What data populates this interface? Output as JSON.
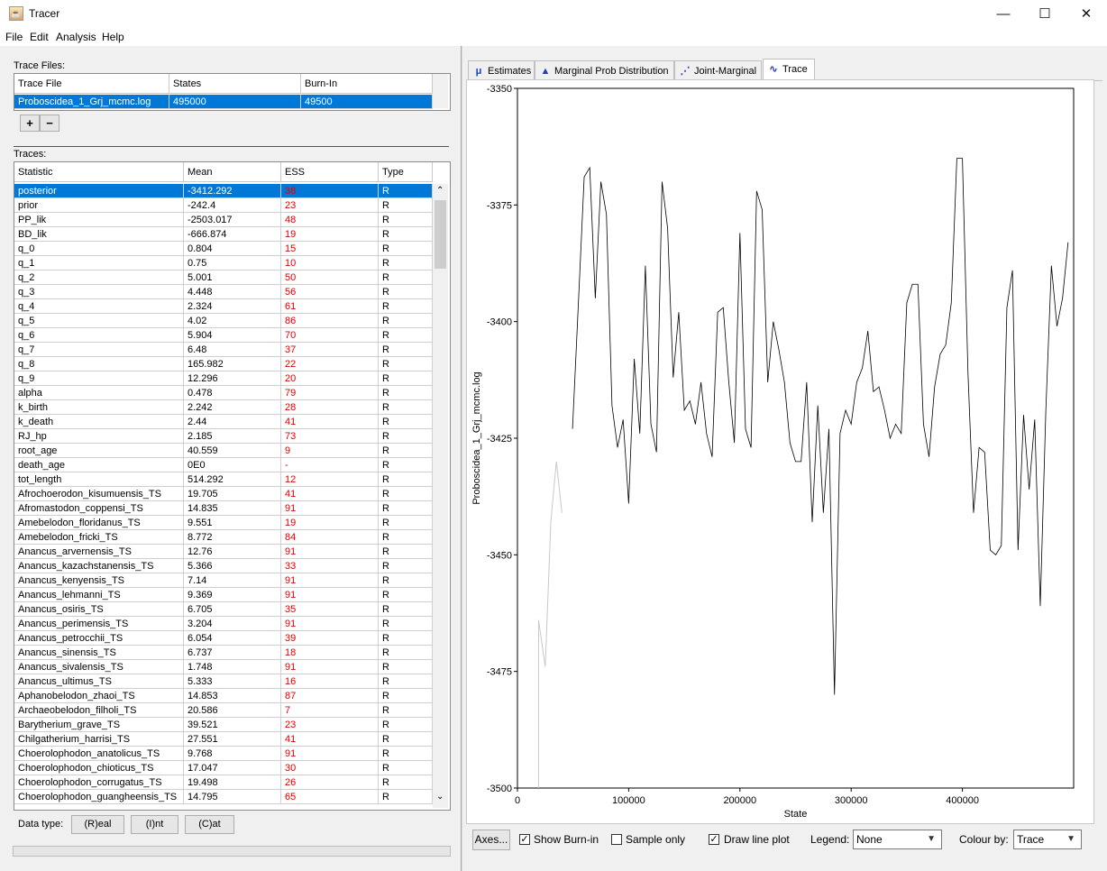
{
  "window": {
    "title": "Tracer",
    "icon": "java-cup-icon",
    "minimize": "—",
    "maximize": "☐",
    "close": "✕"
  },
  "menu": [
    "File",
    "Edit",
    "Analysis",
    "Help"
  ],
  "trace_files": {
    "label": "Trace Files:",
    "headers": [
      "Trace File",
      "States",
      "Burn-In"
    ],
    "rows": [
      {
        "file": "Proboscidea_1_Grj_mcmc.log",
        "states": "495000",
        "burnin": "49500"
      }
    ],
    "add_label": "+",
    "remove_label": "−"
  },
  "traces": {
    "label": "Traces:",
    "headers": [
      "Statistic",
      "Mean",
      "ESS",
      "Type"
    ],
    "rows": [
      [
        "posterior",
        "-3412.292",
        "38",
        "R"
      ],
      [
        "prior",
        "-242.4",
        "23",
        "R"
      ],
      [
        "PP_lik",
        "-2503.017",
        "48",
        "R"
      ],
      [
        "BD_lik",
        "-666.874",
        "19",
        "R"
      ],
      [
        "q_0",
        "0.804",
        "15",
        "R"
      ],
      [
        "q_1",
        "0.75",
        "10",
        "R"
      ],
      [
        "q_2",
        "5.001",
        "50",
        "R"
      ],
      [
        "q_3",
        "4.448",
        "56",
        "R"
      ],
      [
        "q_4",
        "2.324",
        "61",
        "R"
      ],
      [
        "q_5",
        "4.02",
        "86",
        "R"
      ],
      [
        "q_6",
        "5.904",
        "70",
        "R"
      ],
      [
        "q_7",
        "6.48",
        "37",
        "R"
      ],
      [
        "q_8",
        "165.982",
        "22",
        "R"
      ],
      [
        "q_9",
        "12.296",
        "20",
        "R"
      ],
      [
        "alpha",
        "0.478",
        "79",
        "R"
      ],
      [
        "k_birth",
        "2.242",
        "28",
        "R"
      ],
      [
        "k_death",
        "2.44",
        "41",
        "R"
      ],
      [
        "RJ_hp",
        "2.185",
        "73",
        "R"
      ],
      [
        "root_age",
        "40.559",
        "9",
        "R"
      ],
      [
        "death_age",
        "0E0",
        "-",
        "R"
      ],
      [
        "tot_length",
        "514.292",
        "12",
        "R"
      ],
      [
        "Afrochoerodon_kisumuensis_TS",
        "19.705",
        "41",
        "R"
      ],
      [
        "Afromastodon_coppensi_TS",
        "14.835",
        "91",
        "R"
      ],
      [
        "Amebelodon_floridanus_TS",
        "9.551",
        "19",
        "R"
      ],
      [
        "Amebelodon_fricki_TS",
        "8.772",
        "84",
        "R"
      ],
      [
        "Anancus_arvernensis_TS",
        "12.76",
        "91",
        "R"
      ],
      [
        "Anancus_kazachstanensis_TS",
        "5.366",
        "33",
        "R"
      ],
      [
        "Anancus_kenyensis_TS",
        "7.14",
        "91",
        "R"
      ],
      [
        "Anancus_lehmanni_TS",
        "9.369",
        "91",
        "R"
      ],
      [
        "Anancus_osiris_TS",
        "6.705",
        "35",
        "R"
      ],
      [
        "Anancus_perimensis_TS",
        "3.204",
        "91",
        "R"
      ],
      [
        "Anancus_petrocchii_TS",
        "6.054",
        "39",
        "R"
      ],
      [
        "Anancus_sinensis_TS",
        "6.737",
        "18",
        "R"
      ],
      [
        "Anancus_sivalensis_TS",
        "1.748",
        "91",
        "R"
      ],
      [
        "Anancus_ultimus_TS",
        "5.333",
        "16",
        "R"
      ],
      [
        "Aphanobelodon_zhaoi_TS",
        "14.853",
        "87",
        "R"
      ],
      [
        "Archaeobelodon_filholi_TS",
        "20.586",
        "7",
        "R"
      ],
      [
        "Barytherium_grave_TS",
        "39.521",
        "23",
        "R"
      ],
      [
        "Chilgatherium_harrisi_TS",
        "27.551",
        "41",
        "R"
      ],
      [
        "Choerolophodon_anatolicus_TS",
        "9.768",
        "91",
        "R"
      ],
      [
        "Choerolophodon_chioticus_TS",
        "17.047",
        "30",
        "R"
      ],
      [
        "Choerolophodon_corrugatus_TS",
        "19.498",
        "26",
        "R"
      ],
      [
        "Choerolophodon_guangheensis_TS",
        "14.795",
        "65",
        "R"
      ]
    ],
    "selected_index": 0
  },
  "data_type": {
    "label": "Data type:",
    "buttons": [
      "(R)eal",
      "(I)nt",
      "(C)at"
    ]
  },
  "tabs": [
    {
      "label": "Estimates",
      "icon": "mu-icon"
    },
    {
      "label": "Marginal Prob Distribution",
      "icon": "distribution-icon"
    },
    {
      "label": "Joint-Marginal",
      "icon": "scatter-icon"
    },
    {
      "label": "Trace",
      "icon": "trace-icon"
    }
  ],
  "active_tab": 3,
  "bottom_controls": {
    "axes_button": "Axes...",
    "show_burnin": {
      "label": "Show Burn-in",
      "checked": true
    },
    "sample_only": {
      "label": "Sample only",
      "checked": false
    },
    "draw_line_plot": {
      "label": "Draw line plot",
      "checked": true
    },
    "legend_label": "Legend:",
    "legend_value": "None",
    "colour_label": "Colour by:",
    "colour_value": "Trace"
  },
  "chart_data": {
    "type": "line",
    "xlabel": "State",
    "ylabel": "Proboscidea_1_Grj_mcmc.log",
    "xlim": [
      0,
      500000
    ],
    "ylim": [
      -3500,
      -3350
    ],
    "xticks": [
      "0",
      "100000",
      "200000",
      "300000",
      "400000"
    ],
    "yticks": [
      "-3350",
      "-3375",
      "-3400",
      "-3425",
      "-3450",
      "-3475",
      "-3500"
    ],
    "burnin": {
      "x": [
        19000,
        25000,
        30000,
        35000,
        40000
      ],
      "y": [
        -3464,
        -3474,
        -3443,
        -3430,
        -3441
      ]
    },
    "series": [
      {
        "x": [
          49500,
          55000,
          60000,
          65000,
          70000,
          75000,
          80000,
          85000,
          90000,
          95000,
          100000,
          105000,
          110000,
          115000,
          120000,
          125000,
          130000,
          135000,
          140000,
          145000,
          150000,
          155000,
          160000,
          165000,
          170000,
          175000,
          180000,
          185000,
          190000,
          195000,
          200000,
          205000,
          210000,
          215000,
          220000,
          225000,
          230000,
          235000,
          240000,
          245000,
          250000,
          255000,
          260000,
          265000,
          270000,
          275000,
          280000,
          285000,
          290000,
          295000,
          300000,
          305000,
          310000,
          315000,
          320000,
          325000,
          330000,
          335000,
          340000,
          345000,
          350000,
          355000,
          360000,
          365000,
          370000,
          375000,
          380000,
          385000,
          390000,
          395000,
          400000,
          405000,
          410000,
          415000,
          420000,
          425000,
          430000,
          435000,
          440000,
          445000,
          450000,
          455000,
          460000,
          465000,
          470000,
          475000,
          480000,
          485000,
          490000,
          495000
        ],
        "y": [
          -3423,
          -3395,
          -3369,
          -3367,
          -3395,
          -3370,
          -3377,
          -3418,
          -3427,
          -3421,
          -3439,
          -3408,
          -3424,
          -3388,
          -3422,
          -3428,
          -3370,
          -3380,
          -3412,
          -3398,
          -3419,
          -3417,
          -3422,
          -3413,
          -3424,
          -3429,
          -3398,
          -3397,
          -3413,
          -3426,
          -3381,
          -3423,
          -3427,
          -3372,
          -3376,
          -3413,
          -3400,
          -3406,
          -3413,
          -3426,
          -3430,
          -3430,
          -3413,
          -3443,
          -3418,
          -3441,
          -3423,
          -3480,
          -3424,
          -3419,
          -3422,
          -3413,
          -3410,
          -3402,
          -3415,
          -3414,
          -3419,
          -3425,
          -3422,
          -3424,
          -3396,
          -3392,
          -3392,
          -3422,
          -3429,
          -3414,
          -3407,
          -3405,
          -3396,
          -3365,
          -3365,
          -3411,
          -3441,
          -3427,
          -3428,
          -3449,
          -3450,
          -3448,
          -3397,
          -3389,
          -3449,
          -3420,
          -3436,
          -3421,
          -3461,
          -3419,
          -3388,
          -3401,
          -3395,
          -3383
        ]
      }
    ]
  }
}
